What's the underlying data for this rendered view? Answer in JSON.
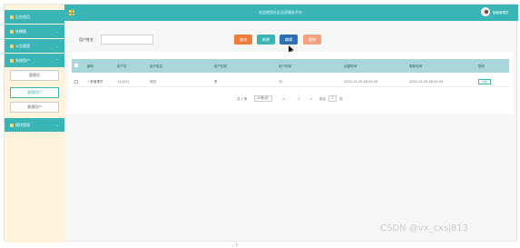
{
  "header": {
    "title": "欢迎使用社区志愿服务平台",
    "username": "超级管理员"
  },
  "sidebar": {
    "items": [
      {
        "label": "后台首页"
      },
      {
        "label": "轮播图"
      },
      {
        "label": "公告管理"
      },
      {
        "label": "系统用户"
      },
      {
        "label": "模块管理"
      }
    ],
    "subitems": [
      {
        "label": "管理员"
      },
      {
        "label": "管理用户"
      },
      {
        "label": "普通用户"
      }
    ]
  },
  "search": {
    "label": "用户姓名",
    "value": "",
    "placeholder": ""
  },
  "buttons": {
    "search": "查询",
    "add": "新增",
    "edit": "编辑",
    "delete": "删除"
  },
  "table": {
    "headers": [
      "编号",
      "用户名",
      "用户姓名",
      "用户性别",
      "用户年龄",
      "创建时间",
      "更新时间",
      "操作"
    ],
    "rows": [
      {
        "id": "一般管理员",
        "username": "11(2(3)",
        "name": "测试",
        "gender": "男",
        "age": "30",
        "created": "2022-12-20 16:12:43",
        "updated": "2022-12-20 16:12:43",
        "action": "详情"
      }
    ]
  },
  "pager": {
    "total": "共 1 条",
    "per_page": "10条/页",
    "prev": "<",
    "page": "1",
    "next": ">",
    "goto_prefix": "前往",
    "goto_value": "1",
    "goto_suffix": "页"
  },
  "watermark": "CSDN @vx_cxsj813",
  "stray": "、)"
}
